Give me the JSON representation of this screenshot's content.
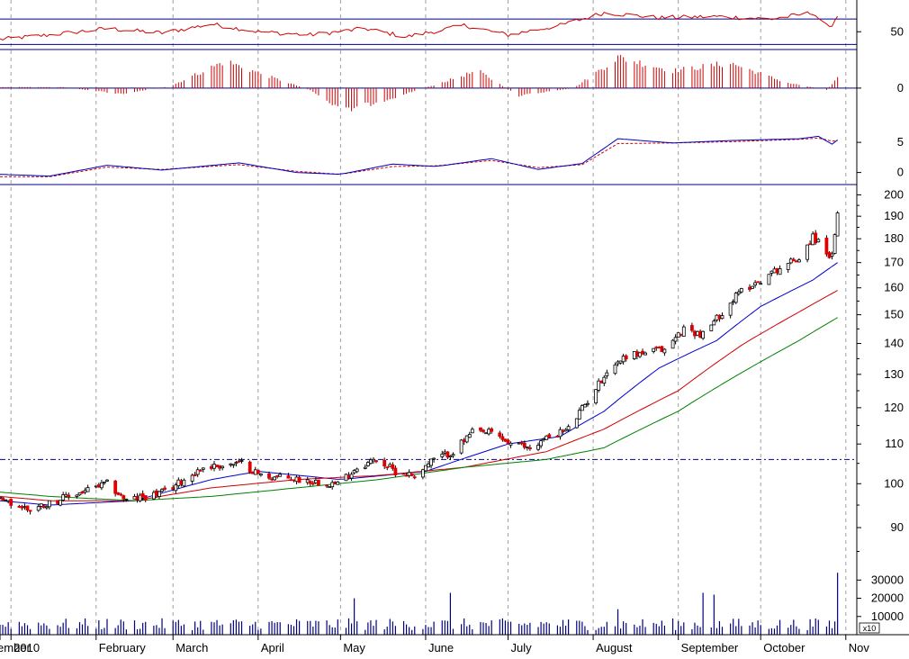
{
  "colors": {
    "background": "#ffffff",
    "gridline": "#a0a0a0",
    "panel_border": "#000080",
    "axis": "#000000",
    "up_candle": "#ffffff",
    "down_candle": "#e00000",
    "candle_outline": "#000000",
    "ma_short": "#0000d0",
    "ma_mid": "#d00000",
    "ma_long": "#008000",
    "rsi_line": "#d00000",
    "macd_hist": "#d00000",
    "macd_line": "#0000c0",
    "macd_signal": "#d00000",
    "volume_bar": "#000080",
    "resistance_line": "#000080"
  },
  "chart_data": {
    "type": "candlestick",
    "x_start": "2009-12-28",
    "x_end": "2010-11-05",
    "months": [
      {
        "label": "ember",
        "date": "2009-12-01"
      },
      {
        "label": "2010",
        "date": "2010-01-01"
      },
      {
        "label": "February",
        "date": "2010-02-01"
      },
      {
        "label": "March",
        "date": "2010-03-01"
      },
      {
        "label": "April",
        "date": "2010-04-01"
      },
      {
        "label": "May",
        "date": "2010-05-01"
      },
      {
        "label": "June",
        "date": "2010-06-01"
      },
      {
        "label": "July",
        "date": "2010-07-01"
      },
      {
        "label": "August",
        "date": "2010-08-01"
      },
      {
        "label": "September",
        "date": "2010-09-01"
      },
      {
        "label": "October",
        "date": "2010-10-01"
      },
      {
        "label": "Nov",
        "date": "2010-11-01"
      }
    ],
    "price_panel": {
      "scale": "log",
      "ylim": [
        84,
        205
      ],
      "ticks": [
        90,
        100,
        110,
        120,
        130,
        140,
        150,
        160,
        170,
        180,
        190,
        200
      ],
      "tick_labels": [
        "90",
        "100",
        "110",
        "120",
        "130",
        "140",
        "150",
        "160",
        "170",
        "180",
        "190",
        "200"
      ],
      "resistance_level": 106,
      "price_path": [
        {
          "date": "2009-12-28",
          "close": 96
        },
        {
          "date": "2010-01-08",
          "close": 94
        },
        {
          "date": "2010-01-22",
          "close": 97
        },
        {
          "date": "2010-02-05",
          "close": 100
        },
        {
          "date": "2010-02-12",
          "close": 96
        },
        {
          "date": "2010-02-26",
          "close": 98
        },
        {
          "date": "2010-03-05",
          "close": 101
        },
        {
          "date": "2010-03-12",
          "close": 104
        },
        {
          "date": "2010-03-26",
          "close": 105
        },
        {
          "date": "2010-04-02",
          "close": 102
        },
        {
          "date": "2010-04-16",
          "close": 101
        },
        {
          "date": "2010-04-30",
          "close": 100
        },
        {
          "date": "2010-05-07",
          "close": 104
        },
        {
          "date": "2010-05-14",
          "close": 106
        },
        {
          "date": "2010-05-21",
          "close": 103
        },
        {
          "date": "2010-05-28",
          "close": 102
        },
        {
          "date": "2010-06-04",
          "close": 106
        },
        {
          "date": "2010-06-11",
          "close": 108
        },
        {
          "date": "2010-06-18",
          "close": 113
        },
        {
          "date": "2010-06-25",
          "close": 113
        },
        {
          "date": "2010-07-02",
          "close": 110
        },
        {
          "date": "2010-07-09",
          "close": 109
        },
        {
          "date": "2010-07-16",
          "close": 112
        },
        {
          "date": "2010-07-23",
          "close": 114
        },
        {
          "date": "2010-07-30",
          "close": 122
        },
        {
          "date": "2010-08-06",
          "close": 131
        },
        {
          "date": "2010-08-13",
          "close": 136
        },
        {
          "date": "2010-08-20",
          "close": 137
        },
        {
          "date": "2010-08-27",
          "close": 138
        },
        {
          "date": "2010-09-03",
          "close": 145
        },
        {
          "date": "2010-09-10",
          "close": 143
        },
        {
          "date": "2010-09-17",
          "close": 151
        },
        {
          "date": "2010-09-24",
          "close": 159
        },
        {
          "date": "2010-10-01",
          "close": 163
        },
        {
          "date": "2010-10-08",
          "close": 168
        },
        {
          "date": "2010-10-15",
          "close": 172
        },
        {
          "date": "2010-10-20",
          "close": 181
        },
        {
          "date": "2010-10-27",
          "close": 172
        },
        {
          "date": "2010-10-29",
          "close": 190
        }
      ],
      "moving_averages": [
        {
          "color_key": "ma_short",
          "points": [
            {
              "date": "2009-12-28",
              "value": 96
            },
            {
              "date": "2010-01-15",
              "value": 95
            },
            {
              "date": "2010-02-15",
              "value": 96
            },
            {
              "date": "2010-03-15",
              "value": 101
            },
            {
              "date": "2010-04-01",
              "value": 103
            },
            {
              "date": "2010-05-01",
              "value": 101
            },
            {
              "date": "2010-06-01",
              "value": 103
            },
            {
              "date": "2010-07-01",
              "value": 110
            },
            {
              "date": "2010-07-20",
              "value": 112
            },
            {
              "date": "2010-08-05",
              "value": 119
            },
            {
              "date": "2010-08-25",
              "value": 132
            },
            {
              "date": "2010-09-15",
              "value": 141
            },
            {
              "date": "2010-10-01",
              "value": 153
            },
            {
              "date": "2010-10-20",
              "value": 163
            },
            {
              "date": "2010-10-29",
              "value": 170
            }
          ]
        },
        {
          "color_key": "ma_mid",
          "points": [
            {
              "date": "2009-12-28",
              "value": 97
            },
            {
              "date": "2010-01-15",
              "value": 96
            },
            {
              "date": "2010-02-15",
              "value": 96
            },
            {
              "date": "2010-03-15",
              "value": 99
            },
            {
              "date": "2010-04-15",
              "value": 101
            },
            {
              "date": "2010-05-15",
              "value": 102
            },
            {
              "date": "2010-06-15",
              "value": 104
            },
            {
              "date": "2010-07-15",
              "value": 108
            },
            {
              "date": "2010-08-05",
              "value": 114
            },
            {
              "date": "2010-09-01",
              "value": 125
            },
            {
              "date": "2010-09-25",
              "value": 140
            },
            {
              "date": "2010-10-15",
              "value": 151
            },
            {
              "date": "2010-10-29",
              "value": 159
            }
          ]
        },
        {
          "color_key": "ma_long",
          "points": [
            {
              "date": "2009-12-28",
              "value": 98
            },
            {
              "date": "2010-01-15",
              "value": 97
            },
            {
              "date": "2010-02-15",
              "value": 96
            },
            {
              "date": "2010-03-15",
              "value": 97
            },
            {
              "date": "2010-04-15",
              "value": 99
            },
            {
              "date": "2010-05-15",
              "value": 101
            },
            {
              "date": "2010-06-15",
              "value": 104
            },
            {
              "date": "2010-07-15",
              "value": 106
            },
            {
              "date": "2010-08-05",
              "value": 109
            },
            {
              "date": "2010-09-01",
              "value": 119
            },
            {
              "date": "2010-09-25",
              "value": 131
            },
            {
              "date": "2010-10-15",
              "value": 141
            },
            {
              "date": "2010-10-29",
              "value": 149
            }
          ]
        }
      ]
    },
    "volume_panel": {
      "ylim": [
        0,
        43000
      ],
      "ticks": [
        10000,
        20000,
        30000
      ],
      "tick_labels": [
        "10000",
        "20000",
        "30000"
      ],
      "unit_label": "x10",
      "spikes": [
        {
          "date": "2010-05-06",
          "value": 20000
        },
        {
          "date": "2010-06-10",
          "value": 23000
        },
        {
          "date": "2010-07-13",
          "value": 7000
        },
        {
          "date": "2010-08-10",
          "value": 14000
        },
        {
          "date": "2010-09-10",
          "value": 23000
        },
        {
          "date": "2010-09-14",
          "value": 22000
        },
        {
          "date": "2010-10-29",
          "value": 34000
        }
      ]
    },
    "rsi_panel": {
      "ylim": [
        22,
        100
      ],
      "ticks": [
        50
      ],
      "tick_labels": [
        "50"
      ],
      "upper_line": 70,
      "lower_line": 30,
      "path": [
        {
          "date": "2009-12-28",
          "value": 38
        },
        {
          "date": "2010-01-15",
          "value": 45
        },
        {
          "date": "2010-02-05",
          "value": 55
        },
        {
          "date": "2010-02-25",
          "value": 48
        },
        {
          "date": "2010-03-15",
          "value": 62
        },
        {
          "date": "2010-04-01",
          "value": 50
        },
        {
          "date": "2010-04-20",
          "value": 45
        },
        {
          "date": "2010-05-10",
          "value": 55
        },
        {
          "date": "2010-05-25",
          "value": 42
        },
        {
          "date": "2010-06-15",
          "value": 60
        },
        {
          "date": "2010-07-01",
          "value": 45
        },
        {
          "date": "2010-07-20",
          "value": 60
        },
        {
          "date": "2010-08-05",
          "value": 80
        },
        {
          "date": "2010-08-25",
          "value": 72
        },
        {
          "date": "2010-09-15",
          "value": 74
        },
        {
          "date": "2010-10-05",
          "value": 70
        },
        {
          "date": "2010-10-20",
          "value": 80
        },
        {
          "date": "2010-10-26",
          "value": 55
        },
        {
          "date": "2010-10-29",
          "value": 75
        }
      ]
    },
    "macd_hist_panel": {
      "ylim": [
        -1.5,
        2.0
      ],
      "ticks": [
        0
      ],
      "tick_labels": [
        "0"
      ],
      "path": [
        {
          "date": "2009-12-28",
          "value": 0.05
        },
        {
          "date": "2010-01-20",
          "value": 0.05
        },
        {
          "date": "2010-02-10",
          "value": -0.3
        },
        {
          "date": "2010-02-28",
          "value": 0.1
        },
        {
          "date": "2010-03-20",
          "value": 1.4
        },
        {
          "date": "2010-04-05",
          "value": 0.6
        },
        {
          "date": "2010-04-20",
          "value": -0.1
        },
        {
          "date": "2010-05-02",
          "value": -1.2
        },
        {
          "date": "2010-05-20",
          "value": -0.5
        },
        {
          "date": "2010-06-05",
          "value": 0.2
        },
        {
          "date": "2010-06-20",
          "value": 0.9
        },
        {
          "date": "2010-07-05",
          "value": -0.4
        },
        {
          "date": "2010-07-25",
          "value": 0.0
        },
        {
          "date": "2010-08-10",
          "value": 1.6
        },
        {
          "date": "2010-08-30",
          "value": 0.9
        },
        {
          "date": "2010-09-20",
          "value": 1.3
        },
        {
          "date": "2010-10-10",
          "value": 0.3
        },
        {
          "date": "2010-10-25",
          "value": -0.1
        },
        {
          "date": "2010-10-29",
          "value": 0.5
        }
      ]
    },
    "macd_line_panel": {
      "ylim": [
        -2.0,
        9.2
      ],
      "ticks": [
        0,
        5
      ],
      "tick_labels": [
        "0",
        "5"
      ],
      "macd": [
        {
          "date": "2009-12-28",
          "value": -0.3
        },
        {
          "date": "2010-01-15",
          "value": -0.6
        },
        {
          "date": "2010-02-05",
          "value": 1.2
        },
        {
          "date": "2010-02-25",
          "value": 0.4
        },
        {
          "date": "2010-03-25",
          "value": 1.6
        },
        {
          "date": "2010-04-15",
          "value": 0.0
        },
        {
          "date": "2010-05-01",
          "value": -0.3
        },
        {
          "date": "2010-05-20",
          "value": 1.4
        },
        {
          "date": "2010-06-05",
          "value": 1.0
        },
        {
          "date": "2010-06-25",
          "value": 2.3
        },
        {
          "date": "2010-07-12",
          "value": 0.5
        },
        {
          "date": "2010-07-28",
          "value": 1.5
        },
        {
          "date": "2010-08-10",
          "value": 5.6
        },
        {
          "date": "2010-08-30",
          "value": 4.9
        },
        {
          "date": "2010-09-20",
          "value": 5.3
        },
        {
          "date": "2010-10-15",
          "value": 5.6
        },
        {
          "date": "2010-10-22",
          "value": 6.0
        },
        {
          "date": "2010-10-27",
          "value": 4.7
        },
        {
          "date": "2010-10-29",
          "value": 5.4
        }
      ],
      "signal": [
        {
          "date": "2009-12-28",
          "value": -0.7
        },
        {
          "date": "2010-01-15",
          "value": -0.7
        },
        {
          "date": "2010-02-05",
          "value": 0.9
        },
        {
          "date": "2010-02-25",
          "value": 0.5
        },
        {
          "date": "2010-03-25",
          "value": 1.3
        },
        {
          "date": "2010-04-15",
          "value": 0.2
        },
        {
          "date": "2010-05-01",
          "value": -0.3
        },
        {
          "date": "2010-05-20",
          "value": 1.0
        },
        {
          "date": "2010-06-05",
          "value": 1.1
        },
        {
          "date": "2010-06-25",
          "value": 2.0
        },
        {
          "date": "2010-07-12",
          "value": 0.8
        },
        {
          "date": "2010-07-28",
          "value": 1.3
        },
        {
          "date": "2010-08-10",
          "value": 4.8
        },
        {
          "date": "2010-08-30",
          "value": 4.9
        },
        {
          "date": "2010-09-20",
          "value": 5.1
        },
        {
          "date": "2010-10-15",
          "value": 5.5
        },
        {
          "date": "2010-10-22",
          "value": 5.7
        },
        {
          "date": "2010-10-27",
          "value": 5.2
        },
        {
          "date": "2010-10-29",
          "value": 5.3
        }
      ]
    }
  }
}
